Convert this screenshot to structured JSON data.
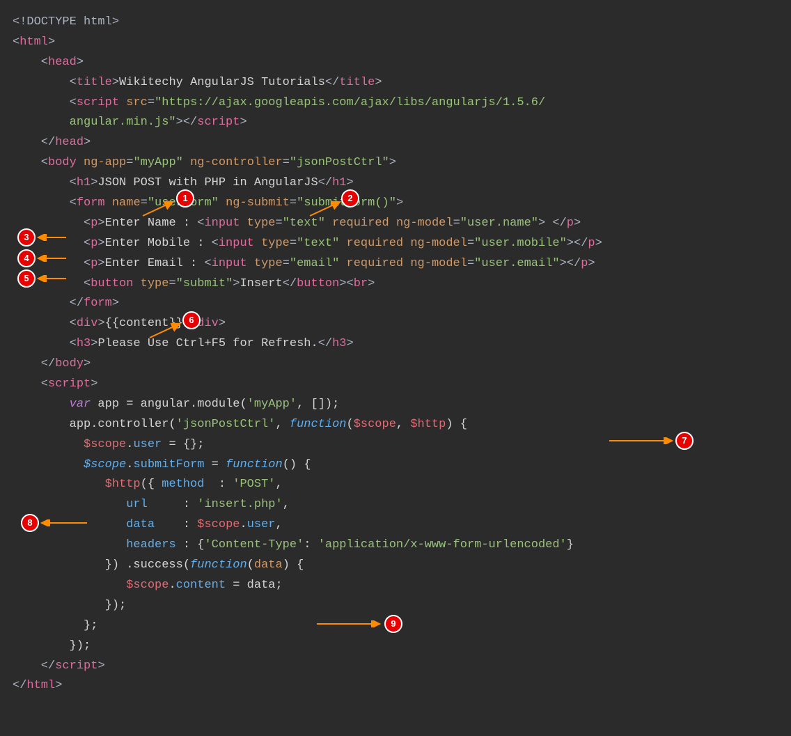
{
  "code": {
    "l1": "<!DOCTYPE html>",
    "l2a": "<",
    "l2b": "html",
    "l2c": ">",
    "l3a": "    <",
    "l3b": "head",
    "l3c": ">",
    "l4a": "        <",
    "l4b": "title",
    "l4c": ">",
    "l4d": "Wikitechy AngularJS Tutorials",
    "l4e": "</",
    "l4f": "title",
    "l4g": ">",
    "l5a": "        <",
    "l5b": "script",
    "l5c": " ",
    "l5d": "src",
    "l5e": "=",
    "l5f": "\"https://ajax.googleapis.com/ajax/libs/angularjs/1.5.6/",
    "l6a": "        angular.min.js\"",
    "l6b": "></",
    "l6c": "script",
    "l6d": ">",
    "l7a": "    </",
    "l7b": "head",
    "l7c": ">",
    "l8a": "    <",
    "l8b": "body",
    "l8c": " ",
    "l8d": "ng-app",
    "l8e": "=",
    "l8f": "\"myApp\"",
    "l8g": " ",
    "l8h": "ng-controller",
    "l8i": "=",
    "l8j": "\"jsonPostCtrl\"",
    "l8k": ">",
    "l9a": "        <",
    "l9b": "h1",
    "l9c": ">",
    "l9d": "JSON POST with PHP in AngularJS",
    "l9e": "</",
    "l9f": "h1",
    "l9g": ">",
    "l10": "",
    "l11a": "        <",
    "l11b": "form",
    "l11c": " ",
    "l11d": "name",
    "l11e": "=",
    "l11f": "\"userForm\"",
    "l11g": " ",
    "l11h": "ng-submit",
    "l11i": "=",
    "l11j": "\"submitForm()\"",
    "l11k": ">",
    "l12a": "          <",
    "l12b": "p",
    "l12c": ">",
    "l12d": "Enter Name : ",
    "l12e": "<",
    "l12f": "input",
    "l12g": " ",
    "l12h": "type",
    "l12i": "=",
    "l12j": "\"text\"",
    "l12k": " ",
    "l12l": "required",
    "l12m": " ",
    "l12n": "ng-model",
    "l12o": "=",
    "l12p": "\"user.name\"",
    "l12q": ">",
    "l12r": " </",
    "l12s": "p",
    "l12t": ">",
    "l13a": "          <",
    "l13b": "p",
    "l13c": ">",
    "l13d": "Enter Mobile : ",
    "l13e": "<",
    "l13f": "input",
    "l13g": " ",
    "l13h": "type",
    "l13i": "=",
    "l13j": "\"text\"",
    "l13k": " ",
    "l13l": "required",
    "l13m": " ",
    "l13n": "ng-model",
    "l13o": "=",
    "l13p": "\"user.mobile\"",
    "l13q": ">",
    "l13r": "</",
    "l13s": "p",
    "l13t": ">",
    "l14a": "          <",
    "l14b": "p",
    "l14c": ">",
    "l14d": "Enter Email : ",
    "l14e": "<",
    "l14f": "input",
    "l14g": " ",
    "l14h": "type",
    "l14i": "=",
    "l14j": "\"email\"",
    "l14k": " ",
    "l14l": "required",
    "l14m": " ",
    "l14n": "ng-model",
    "l14o": "=",
    "l14p": "\"user.email\"",
    "l14q": ">",
    "l14r": "</",
    "l14s": "p",
    "l14t": ">",
    "l15a": "          <",
    "l15b": "button",
    "l15c": " ",
    "l15d": "type",
    "l15e": "=",
    "l15f": "\"submit\"",
    "l15g": ">",
    "l15h": "Insert",
    "l15i": "</",
    "l15j": "button",
    "l15k": ">",
    "l15l": "<",
    "l15m": "br",
    "l15n": ">",
    "l16a": "        </",
    "l16b": "form",
    "l16c": ">",
    "l17a": "        <",
    "l17b": "div",
    "l17c": ">",
    "l17d": "{{content}}",
    "l17e": "</",
    "l17f": "div",
    "l17g": ">",
    "l18a": "        <",
    "l18b": "h3",
    "l18c": ">",
    "l18d": "Please Use Ctrl+F5 for Refresh.",
    "l18e": "</",
    "l18f": "h3",
    "l18g": ">",
    "l19a": "    </",
    "l19b": "body",
    "l19c": ">",
    "l20a": "    <",
    "l20b": "script",
    "l20c": ">",
    "l21a": "        ",
    "l21b": "var",
    "l21c": " app = angular.module(",
    "l21d": "'myApp'",
    "l21e": ", []);",
    "l22a": "        app.controller(",
    "l22b": "'jsonPostCtrl'",
    "l22c": ", ",
    "l22d": "function",
    "l22e": "(",
    "l22f": "$scope",
    "l22g": ", ",
    "l22h": "$http",
    "l22i": ") {",
    "l23": "",
    "l24a": "          ",
    "l24b": "$scope",
    "l24c": ".",
    "l24d": "user",
    "l24e": " = {};",
    "l25a": "          ",
    "l25b": "$scope",
    "l25c": ".",
    "l25d": "submitForm",
    "l25e": " = ",
    "l25f": "function",
    "l25g": "() {",
    "l26a": "             ",
    "l26b": "$http",
    "l26c": "({ ",
    "l26d": "method",
    "l26e": "  : ",
    "l26f": "'POST'",
    "l26g": ",",
    "l27a": "                ",
    "l27b": "url",
    "l27c": "     : ",
    "l27d": "'insert.php'",
    "l27e": ",",
    "l28a": "                ",
    "l28b": "data",
    "l28c": "    : ",
    "l28d": "$scope",
    "l28e": ".",
    "l28f": "user",
    "l28g": ",",
    "l29a": "                ",
    "l29b": "headers",
    "l29c": " : {",
    "l29d": "'Content-Type'",
    "l29e": ": ",
    "l29f": "'application/x-www-form-urlencoded'",
    "l29g": "}",
    "l30a": "             }) .success(",
    "l30b": "function",
    "l30c": "(",
    "l30d": "data",
    "l30e": ") {",
    "l31a": "                ",
    "l31b": "$scope",
    "l31c": ".",
    "l31d": "content",
    "l31e": " = data;",
    "l32": "             });",
    "l33": "          };",
    "l34": "        });",
    "l35a": "    </",
    "l35b": "script",
    "l35c": ">",
    "l36a": "</",
    "l36b": "html",
    "l36c": ">"
  },
  "badges": {
    "b1": "1",
    "b2": "2",
    "b3": "3",
    "b4": "4",
    "b5": "5",
    "b6": "6",
    "b7": "7",
    "b8": "8",
    "b9": "9"
  }
}
